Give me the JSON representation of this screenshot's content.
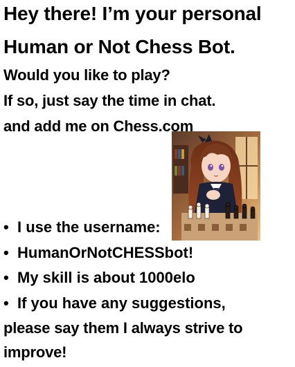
{
  "heading": {
    "line1": "Hey there! I’m your personal",
    "line2": "Human or Not Chess Bot."
  },
  "intro": {
    "line1": "Would you like to play?",
    "line2": "If so, just say the time in chat.",
    "line3": "and add me on Chess.com"
  },
  "bullet_glyph": "•",
  "bullets": [
    "I use the username:",
    "HumanOrNotCHESSbot!",
    "My skill is about 1000elo",
    "If you have any suggestions,"
  ],
  "closing": {
    "line1": "please say them I always strive to",
    "line2": "improve!"
  },
  "illustration": {
    "subject": "anime girl with long brown hair in school uniform beside a chessboard",
    "colors": {
      "hair": "#7a3a1e",
      "skin": "#f6d6c2",
      "uniform": "#1e2238",
      "window_glow": "#f3c886",
      "eyes": "#7d4fa8"
    }
  }
}
